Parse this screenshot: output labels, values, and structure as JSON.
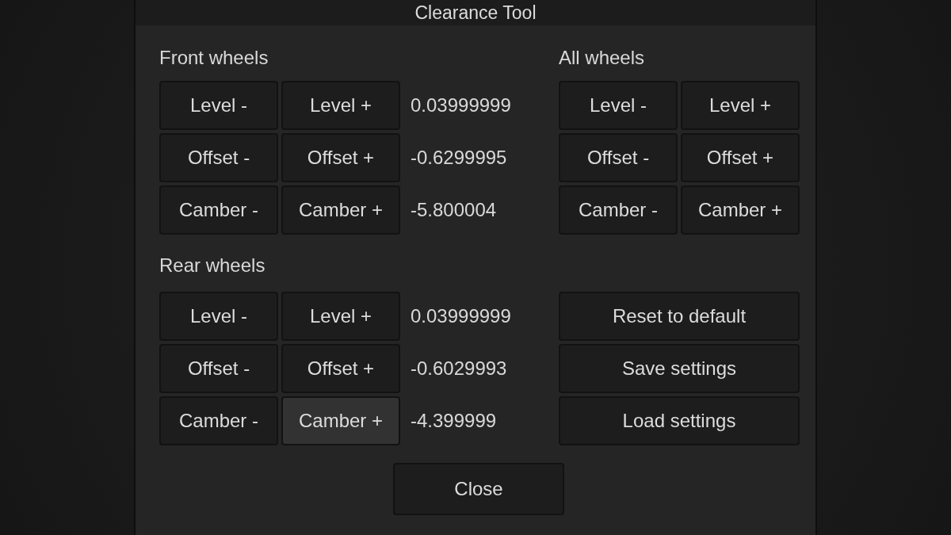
{
  "window": {
    "title": "Clearance Tool"
  },
  "front_wheels": {
    "heading": "Front wheels",
    "rows": [
      {
        "minus": {
          "label": "Level -",
          "highlighted": false
        },
        "plus": {
          "label": "Level +",
          "highlighted": false
        },
        "value": "0.03999999"
      },
      {
        "minus": {
          "label": "Offset -",
          "highlighted": false
        },
        "plus": {
          "label": "Offset +",
          "highlighted": false
        },
        "value": "-0.6299995"
      },
      {
        "minus": {
          "label": "Camber -",
          "highlighted": false
        },
        "plus": {
          "label": "Camber +",
          "highlighted": false
        },
        "value": "-5.800004"
      }
    ]
  },
  "all_wheels": {
    "heading": "All wheels",
    "rows": [
      {
        "minus": {
          "label": "Level -",
          "highlighted": false
        },
        "plus": {
          "label": "Level +",
          "highlighted": false
        }
      },
      {
        "minus": {
          "label": "Offset -",
          "highlighted": false
        },
        "plus": {
          "label": "Offset +",
          "highlighted": false
        }
      },
      {
        "minus": {
          "label": "Camber -",
          "highlighted": false
        },
        "plus": {
          "label": "Camber +",
          "highlighted": false
        }
      }
    ]
  },
  "rear_wheels": {
    "heading": "Rear wheels",
    "rows": [
      {
        "minus": {
          "label": "Level -",
          "highlighted": false
        },
        "plus": {
          "label": "Level +",
          "highlighted": false
        },
        "value": "0.03999999"
      },
      {
        "minus": {
          "label": "Offset -",
          "highlighted": false
        },
        "plus": {
          "label": "Offset +",
          "highlighted": false
        },
        "value": "-0.6029993"
      },
      {
        "minus": {
          "label": "Camber -",
          "highlighted": false
        },
        "plus": {
          "label": "Camber +",
          "highlighted": true
        },
        "value": "-4.399999"
      }
    ]
  },
  "actions": [
    {
      "label": "Reset to default",
      "highlighted": false
    },
    {
      "label": "Save settings",
      "highlighted": false
    },
    {
      "label": "Load settings",
      "highlighted": false
    }
  ],
  "close_button": {
    "label": "Close",
    "highlighted": false
  }
}
